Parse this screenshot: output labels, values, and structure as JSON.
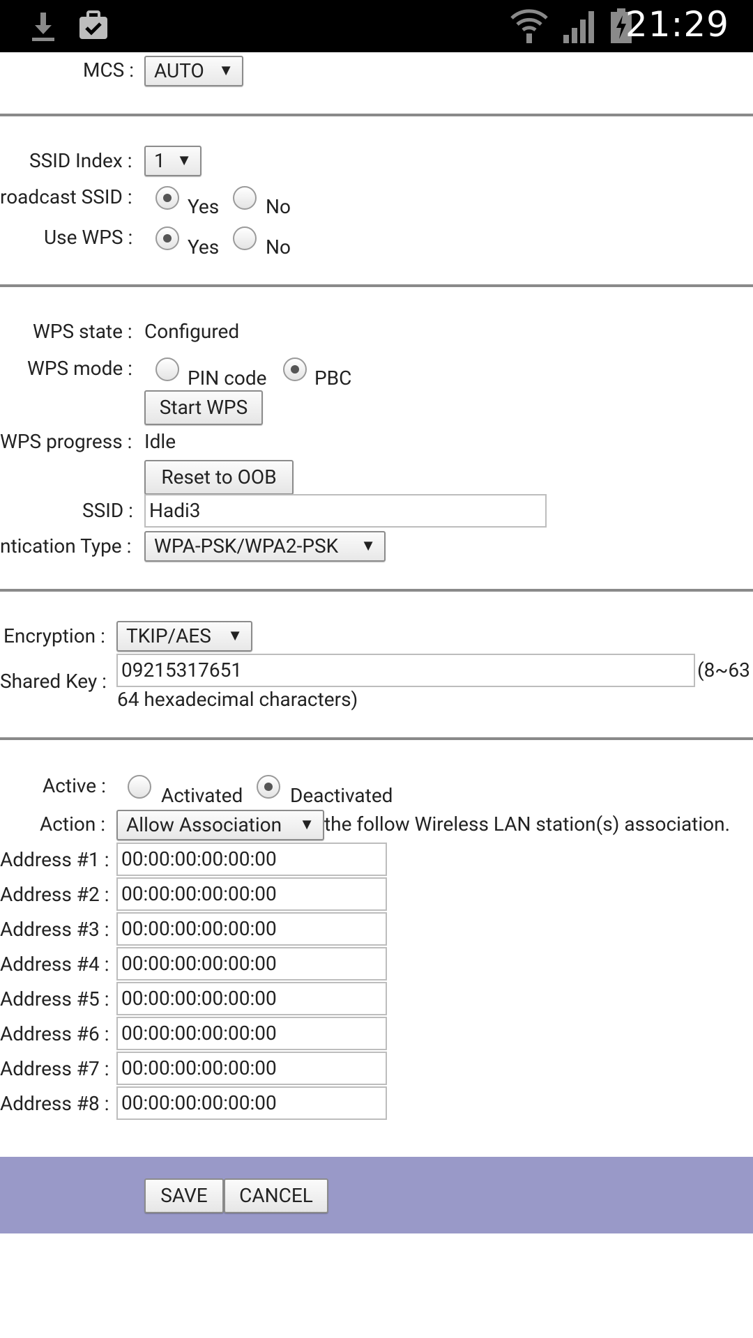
{
  "status_bar": {
    "time": "21:29",
    "icons": [
      "download-icon",
      "briefcase-check-icon",
      "wifi-icon",
      "signal-icon",
      "battery-charging-icon"
    ]
  },
  "mcs": {
    "label": "MCS :",
    "value": "AUTO"
  },
  "ssid_index": {
    "label": "SSID Index :",
    "value": "1"
  },
  "broadcast_ssid": {
    "label": "roadcast SSID :",
    "yes": "Yes",
    "no": "No",
    "selected": "Yes"
  },
  "use_wps": {
    "label": "Use WPS :",
    "yes": "Yes",
    "no": "No",
    "selected": "Yes"
  },
  "wps_state": {
    "label": "WPS state :",
    "value": "Configured"
  },
  "wps_mode": {
    "label": "WPS mode :",
    "pin": "PIN code",
    "pbc": "PBC",
    "selected": "PBC"
  },
  "start_wps": "Start WPS",
  "wps_progress": {
    "label": "WPS progress :",
    "value": "Idle"
  },
  "reset_oob": "Reset to OOB",
  "ssid": {
    "label": "SSID :",
    "value": "Hadi3"
  },
  "auth_type": {
    "label": "ntication Type :",
    "value": "WPA-PSK/WPA2-PSK"
  },
  "encryption": {
    "label": "Encryption :",
    "value": "TKIP/AES"
  },
  "shared_key": {
    "label": "Shared Key :",
    "value": "09215317651",
    "hint": "(8~63",
    "hint2": "64 hexadecimal characters)"
  },
  "active": {
    "label": "Active :",
    "activated": "Activated",
    "deactivated": "Deactivated",
    "selected": "Deactivated"
  },
  "action": {
    "label": "Action :",
    "value": "Allow Association",
    "suffix": "the follow Wireless LAN station(s) association."
  },
  "mac_addresses": [
    {
      "label": "Address #1 :",
      "value": "00:00:00:00:00:00"
    },
    {
      "label": "Address #2 :",
      "value": "00:00:00:00:00:00"
    },
    {
      "label": "Address #3 :",
      "value": "00:00:00:00:00:00"
    },
    {
      "label": "Address #4 :",
      "value": "00:00:00:00:00:00"
    },
    {
      "label": "Address #5 :",
      "value": "00:00:00:00:00:00"
    },
    {
      "label": "Address #6 :",
      "value": "00:00:00:00:00:00"
    },
    {
      "label": "Address #7 :",
      "value": "00:00:00:00:00:00"
    },
    {
      "label": "Address #8 :",
      "value": "00:00:00:00:00:00"
    }
  ],
  "footer": {
    "save": "SAVE",
    "cancel": "CANCEL",
    "color": "#9999c8"
  }
}
